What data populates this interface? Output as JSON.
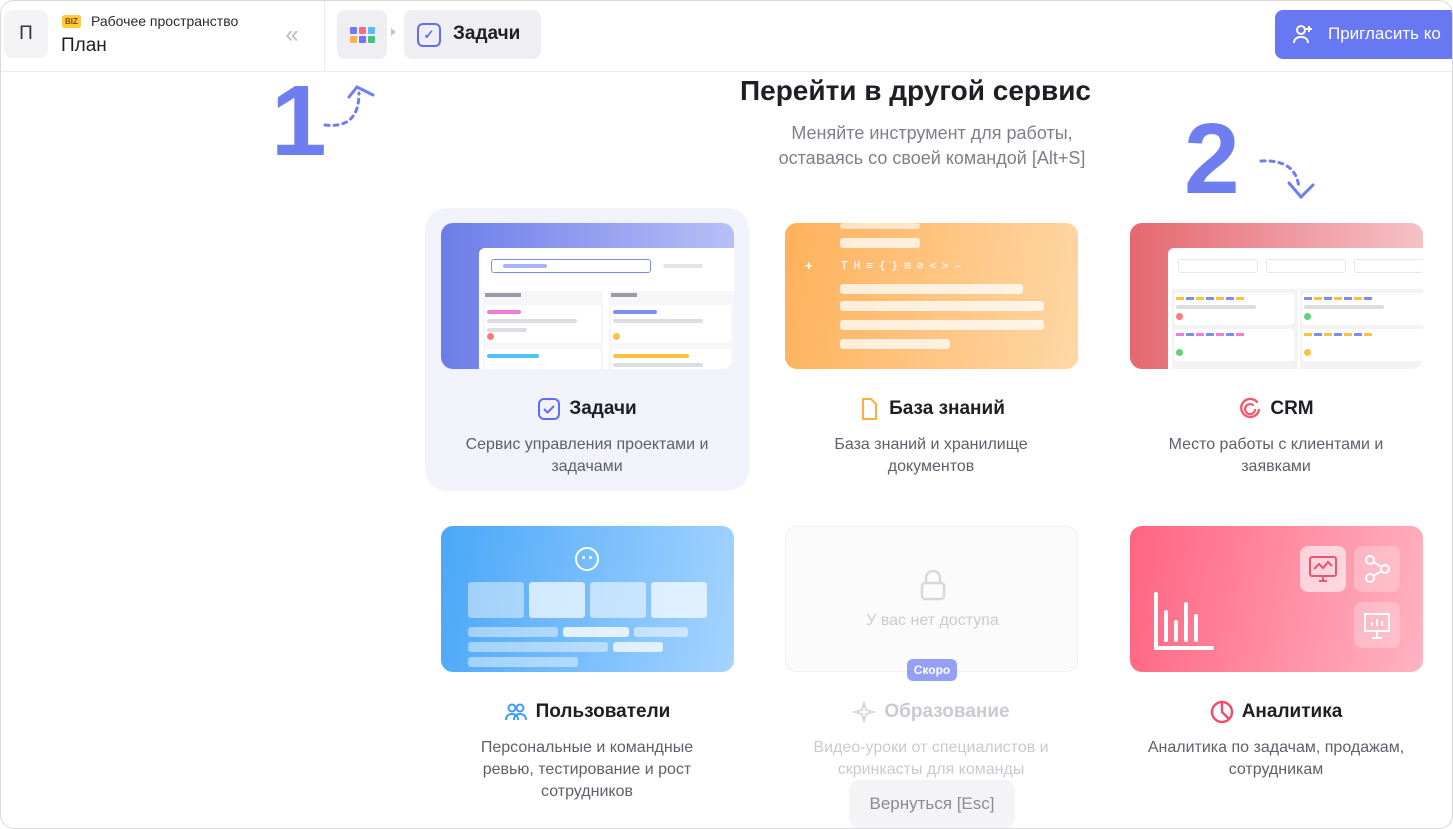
{
  "header": {
    "workspace_badge": "BIZ",
    "workspace_label": "Рабочее пространство",
    "workspace_name": "План",
    "workspace_avatar": "П",
    "breadcrumb_current": "Задачи",
    "invite_label": "Пригласить ко"
  },
  "switcher": {
    "title": "Перейти в другой сервис",
    "subtitle_line1": "Меняйте инструмент для работы,",
    "subtitle_line2": "оставаясь со своей командой [Alt+S]",
    "annotation_1": "1",
    "annotation_2": "2",
    "back_label": "Вернуться [Esc]"
  },
  "services": [
    {
      "title": "Задачи",
      "desc": "Сервис управления проектами и задачами",
      "icon": "check-square-icon"
    },
    {
      "title": "База знаний",
      "desc": "База знаний и хранилище документов",
      "icon": "document-icon"
    },
    {
      "title": "CRM",
      "desc": "Место работы с клиентами и заявками",
      "icon": "crm-icon"
    },
    {
      "title": "Пользователи",
      "desc": "Персональные и командные ревью, тестирование и рост сотрудников",
      "icon": "users-icon"
    },
    {
      "title": "Образование",
      "desc": "Видео-уроки от специалистов и скринкасты для команды",
      "icon": "sparkle-icon",
      "no_access": "У вас нет доступа",
      "badge": "Скоро"
    },
    {
      "title": "Аналитика",
      "desc": "Аналитика по задачам, продажам, сотрудникам",
      "icon": "pie-chart-icon"
    }
  ],
  "colors": {
    "accent": "#6878f2",
    "tasks_gradient": [
      "#6c7ce8",
      "#b6c0f7"
    ],
    "kb_gradient": [
      "#ffb15a",
      "#ffd7a6"
    ],
    "crm_gradient": [
      "#e86a72",
      "#f6c2c6"
    ],
    "users_gradient": [
      "#4aa7f8",
      "#a5d4ff"
    ],
    "analytics_gradient": [
      "#ff6480",
      "#ffb3c2"
    ]
  }
}
